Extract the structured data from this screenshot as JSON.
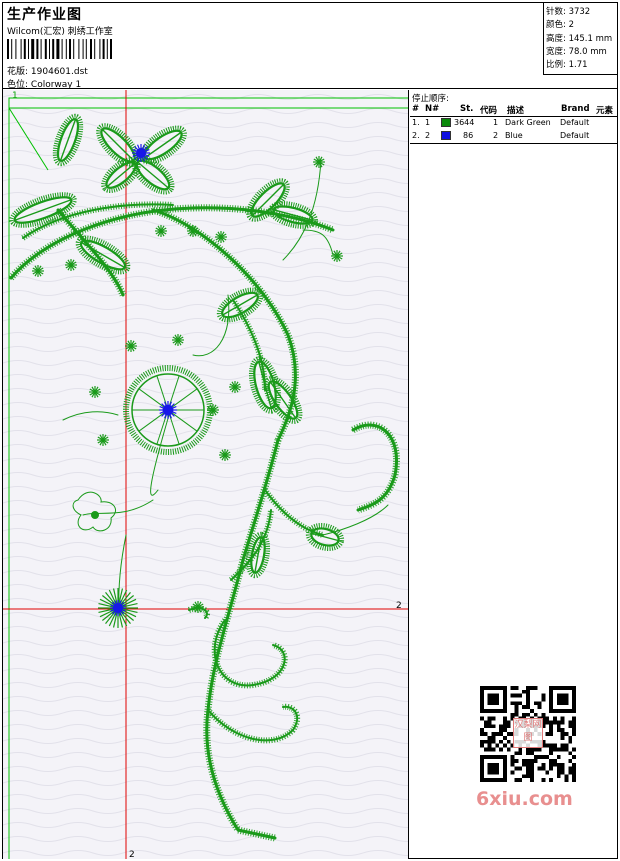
{
  "header": {
    "title": "生产作业图",
    "company": "Wilcom(汇宏) 刺绣工作室",
    "design_label": "花版:",
    "design_value": "1904601.dst",
    "colorway_label": "色位:",
    "colorway_value": "Colorway 1"
  },
  "stats": [
    {
      "label": "针数:",
      "value": "3732"
    },
    {
      "label": "颜色:",
      "value": "2"
    },
    {
      "label": "高度:",
      "value": "145.1 mm"
    },
    {
      "label": "宽度:",
      "value": "78.0 mm"
    },
    {
      "label": "比例:",
      "value": "1.71"
    }
  ],
  "stop_sequence": {
    "title": "停止顺序:",
    "columns": [
      "#",
      "N#",
      "St.",
      "代码",
      "描述",
      "Brand",
      "元素"
    ],
    "rows": [
      {
        "index": "1.",
        "needle": "1",
        "stitches": "3644",
        "code": "1",
        "desc": "Dark Green",
        "brand": "Default",
        "color": "#0a8a0a"
      },
      {
        "index": "2.",
        "needle": "2",
        "stitches": "86",
        "code": "2",
        "desc": "Blue",
        "brand": "Default",
        "color": "#1010e0"
      }
    ]
  },
  "markers": {
    "corner_label": "1",
    "h_label": "2",
    "v_label": "2"
  },
  "colors": {
    "thread_green": "#1a9a1a",
    "thread_blue": "#1818e8",
    "guide_red": "#e00000",
    "guide_green": "#00c000"
  },
  "watermark": {
    "seal_text": "汉梨网图",
    "site": "6xiu.com"
  }
}
